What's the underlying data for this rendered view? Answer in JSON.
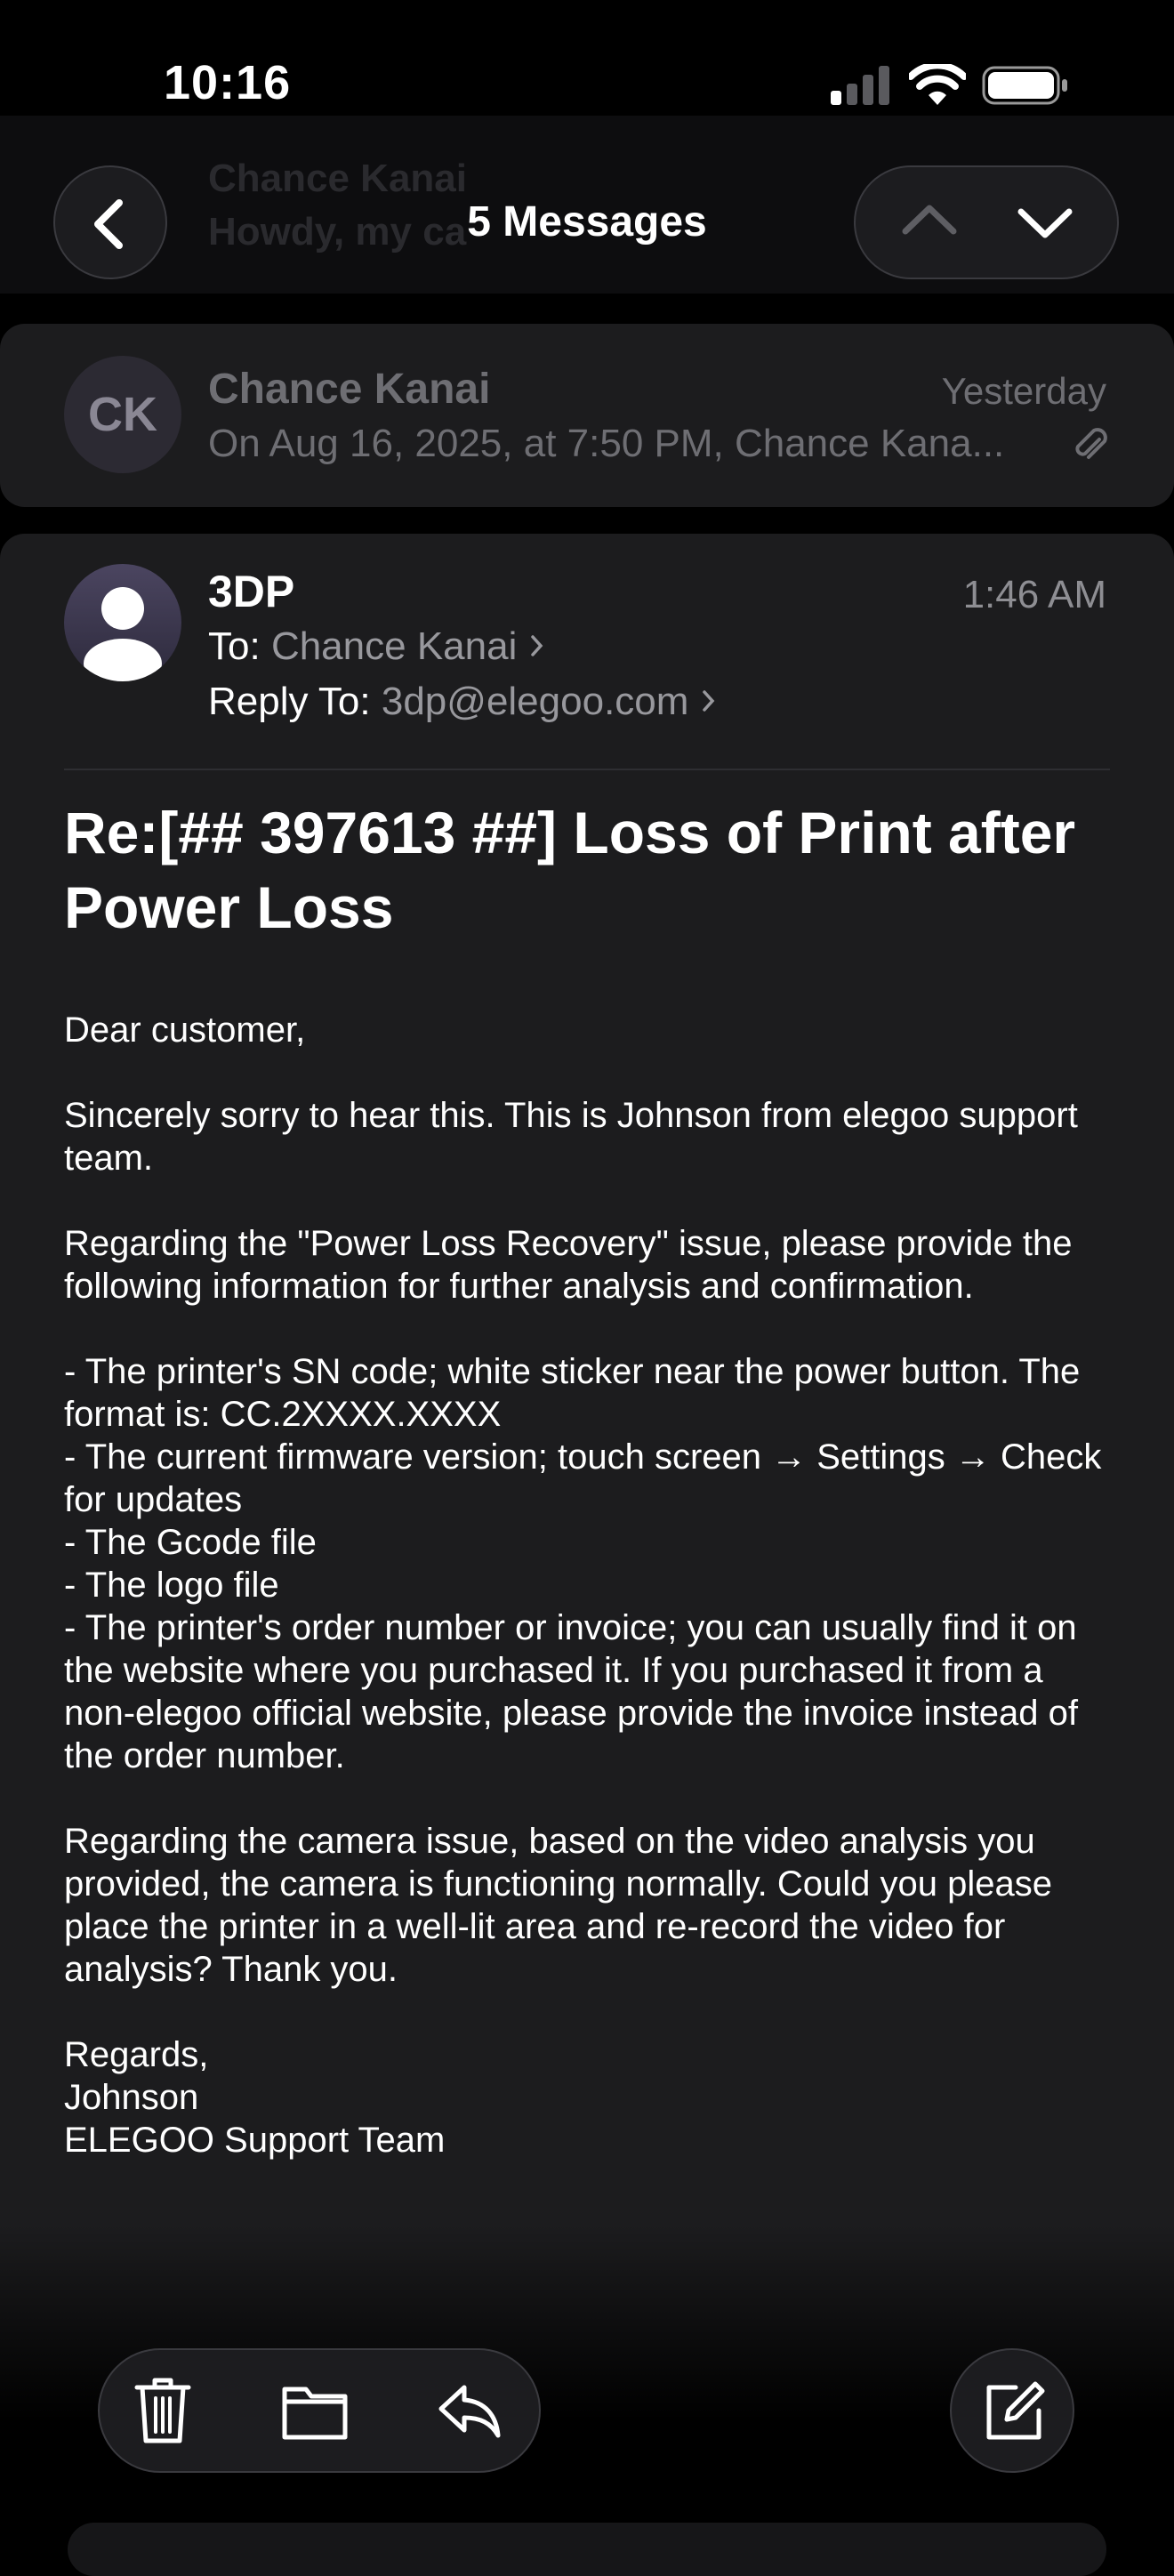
{
  "status_bar": {
    "time": "10:16"
  },
  "nav": {
    "title": "5 Messages",
    "ghost_sender": "Chance Kanai",
    "ghost_preview": "Howdy, my ca"
  },
  "previous_message": {
    "avatar_initials": "CK",
    "sender": "Chance Kanai",
    "date": "Yesterday",
    "snippet": "On Aug 16, 2025, at 7:50 PM, Chance Kana..."
  },
  "message": {
    "sender": "3DP",
    "time": "1:46 AM",
    "to_label": "To:",
    "to_value": "Chance Kanai",
    "reply_label": "Reply To:",
    "reply_value": "3dp@elegoo.com",
    "subject": "Re:[## 397613 ##] Loss of Print after Power Loss",
    "body": [
      "Dear customer,",
      "Sincerely sorry to hear this. This is Johnson from elegoo support team.",
      "Regarding the \"Power Loss Recovery\" issue, please provide the following information for further analysis and confirmation.",
      "- The printer's SN code; white sticker near the power button. The format is: CC.2XXXX.XXXX\n- The current firmware version; touch screen → Settings → Check for updates\n- The Gcode file\n- The logo file\n- The printer's order number or invoice; you can usually find it on the website where you purchased it. If you purchased it from a non-elegoo official website, please provide the invoice instead of the order number.",
      "Regarding the camera issue, based on the video analysis you provided, the camera is functioning normally. Could you please place the printer in a well-lit area and re-record the video for analysis? Thank you.",
      "Regards,\nJohnson\nELEGOO Support Team"
    ]
  },
  "icons": {
    "back": "chevron-left-icon",
    "up": "chevron-up-icon",
    "down": "chevron-down-icon",
    "attachment": "paperclip-icon",
    "trash": "trash-icon",
    "folder": "folder-icon",
    "reply": "reply-icon",
    "compose": "compose-icon"
  }
}
